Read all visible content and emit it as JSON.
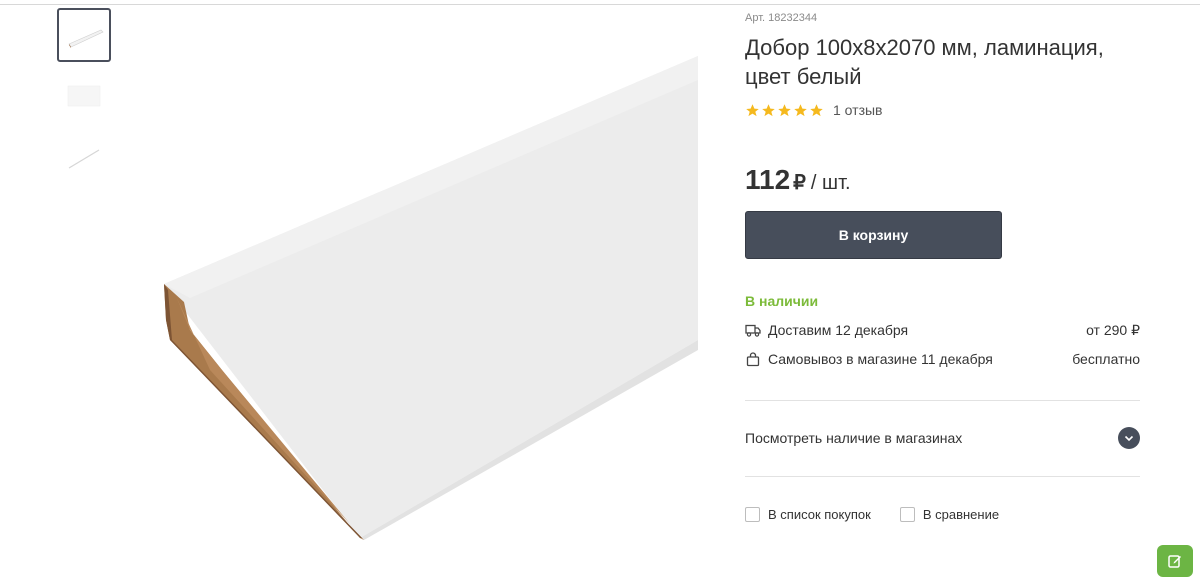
{
  "gallery": {
    "thumbnails": [
      {
        "label": "thumbnail-1",
        "active": true
      },
      {
        "label": "thumbnail-2",
        "active": false
      },
      {
        "label": "thumbnail-3",
        "active": false
      }
    ]
  },
  "product": {
    "sku": "Арт. 18232344",
    "title": "Добор 100х8х2070 мм, ламинация, цвет белый",
    "rating": 5,
    "reviews_text": "1 отзыв",
    "price_value": "112",
    "price_currency": "₽",
    "price_unit": "/ шт.",
    "cart_button": "В корзину"
  },
  "availability": {
    "status": "В наличии",
    "delivery_text": "Доставим 12 декабря",
    "delivery_price": "от 290 ₽",
    "pickup_text": "Самовывоз в магазине 11 декабря",
    "pickup_price": "бесплатно",
    "stores_link": "Посмотреть наличие в магазинах"
  },
  "actions": {
    "shopping_list": "В список покупок",
    "compare": "В сравнение"
  },
  "colors": {
    "accent_dark": "#474e5b",
    "in_stock_green": "#7cbb3a",
    "star_yellow": "#f5b91e",
    "fab_green": "#6cb544"
  }
}
